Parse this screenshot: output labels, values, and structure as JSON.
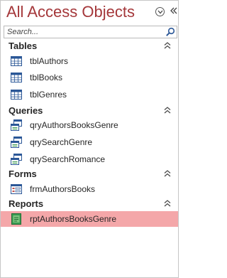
{
  "pane": {
    "title": "All Access Objects",
    "search_placeholder": "Search..."
  },
  "groups": {
    "tables": {
      "title": "Tables",
      "items": [
        "tblAuthors",
        "tblBooks",
        "tblGenres"
      ]
    },
    "queries": {
      "title": "Queries",
      "items": [
        "qryAuthorsBooksGenre",
        "qrySearchGenre",
        "qrySearchRomance"
      ]
    },
    "forms": {
      "title": "Forms",
      "items": [
        "frmAuthorsBooks"
      ]
    },
    "reports": {
      "title": "Reports",
      "items": [
        "rptAuthorsBooksGenre"
      ]
    }
  },
  "selected_item": "rptAuthorsBooksGenre",
  "colors": {
    "title": "#a4373a",
    "selected_row": "#f4a7a9"
  }
}
